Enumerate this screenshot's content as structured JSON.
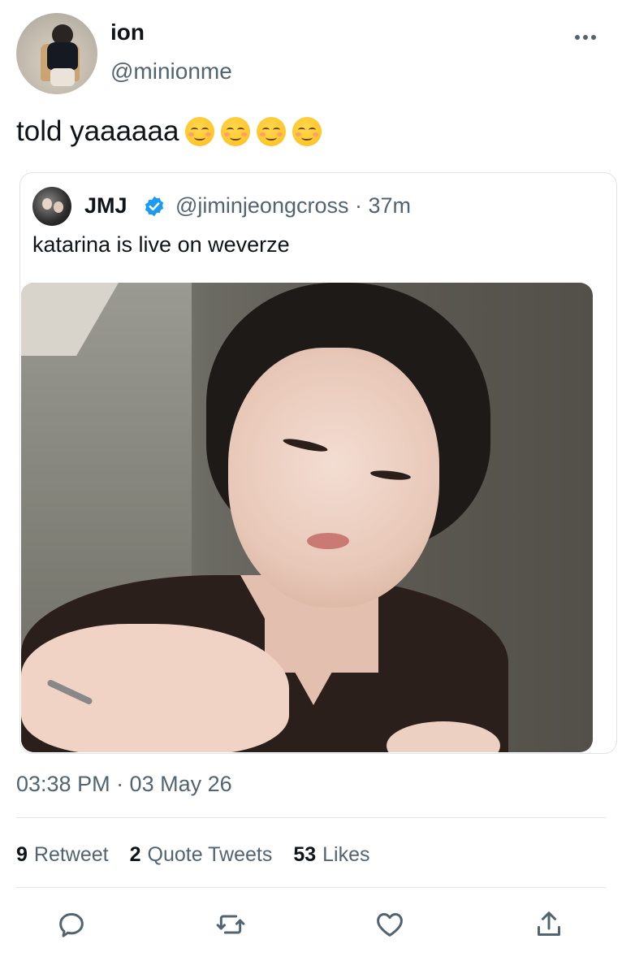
{
  "author": {
    "name": "ion",
    "handle": "@minionme"
  },
  "tweet": {
    "text": "told yaaaaaa",
    "emojis": [
      "smiling-face-icon",
      "smiling-face-icon",
      "smiling-face-icon",
      "smiling-face-icon"
    ]
  },
  "quoted": {
    "name": "JMJ",
    "handle": "@jiminjeongcross · 37m",
    "text": "katarina is live on weverze",
    "verified": true
  },
  "meta": {
    "timestamp": "03:38 PM · 03 May 26"
  },
  "stats": {
    "retweets_count": "9",
    "retweets_label": "Retweet",
    "quotes_count": "2",
    "quotes_label": "Quote Tweets",
    "likes_count": "53",
    "likes_label": "Likes"
  },
  "actions": [
    "reply-icon",
    "retweet-icon",
    "like-icon",
    "share-icon"
  ],
  "colors": {
    "text": "#0f1419",
    "secondary": "#536471",
    "verified": "#1d9bf0",
    "border": "#dfe3e8"
  }
}
